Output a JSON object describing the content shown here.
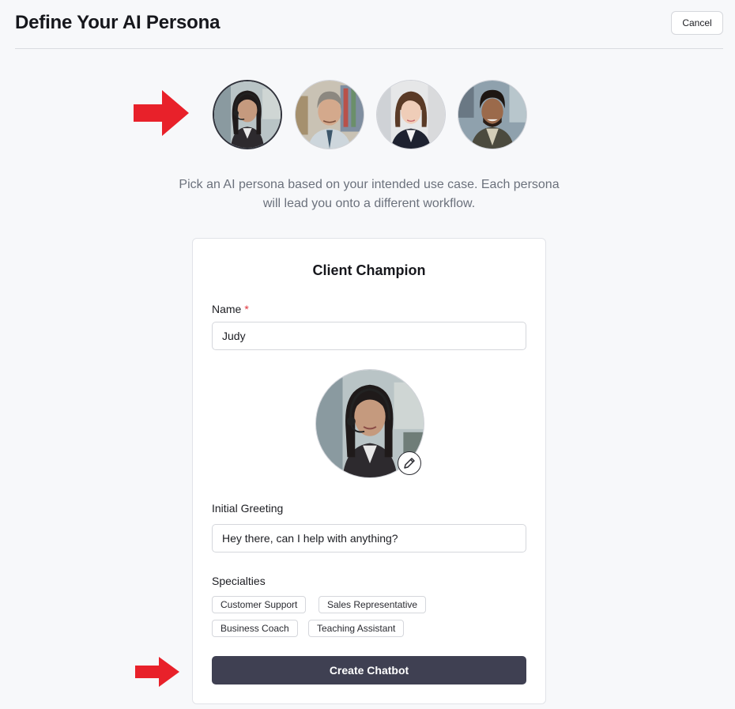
{
  "header": {
    "title": "Define Your AI Persona",
    "cancel_label": "Cancel"
  },
  "personas": [
    {
      "name": "persona-woman-headset",
      "selected": true
    },
    {
      "name": "persona-older-man",
      "selected": false
    },
    {
      "name": "persona-young-woman",
      "selected": false
    },
    {
      "name": "persona-smiling-man",
      "selected": false
    }
  ],
  "intro": {
    "line1": "Pick an AI persona based on your intended use case. Each persona",
    "line2": "will lead you onto a different workflow."
  },
  "card": {
    "title": "Client Champion",
    "name_label": "Name",
    "required_marker": "*",
    "name_value": "Judy",
    "greeting_label": "Initial Greeting",
    "greeting_value": "Hey there, can I help with anything?",
    "specialties_label": "Specialties",
    "specialties": [
      "Customer Support",
      "Sales Representative",
      "Business Coach",
      "Teaching Assistant"
    ],
    "create_label": "Create Chatbot"
  },
  "colors": {
    "accent_button": "#3f4052",
    "annotation_arrow": "#e8212a",
    "required": "#e0333b"
  },
  "icons": [
    "pencil-icon",
    "red-arrow-annotation"
  ]
}
